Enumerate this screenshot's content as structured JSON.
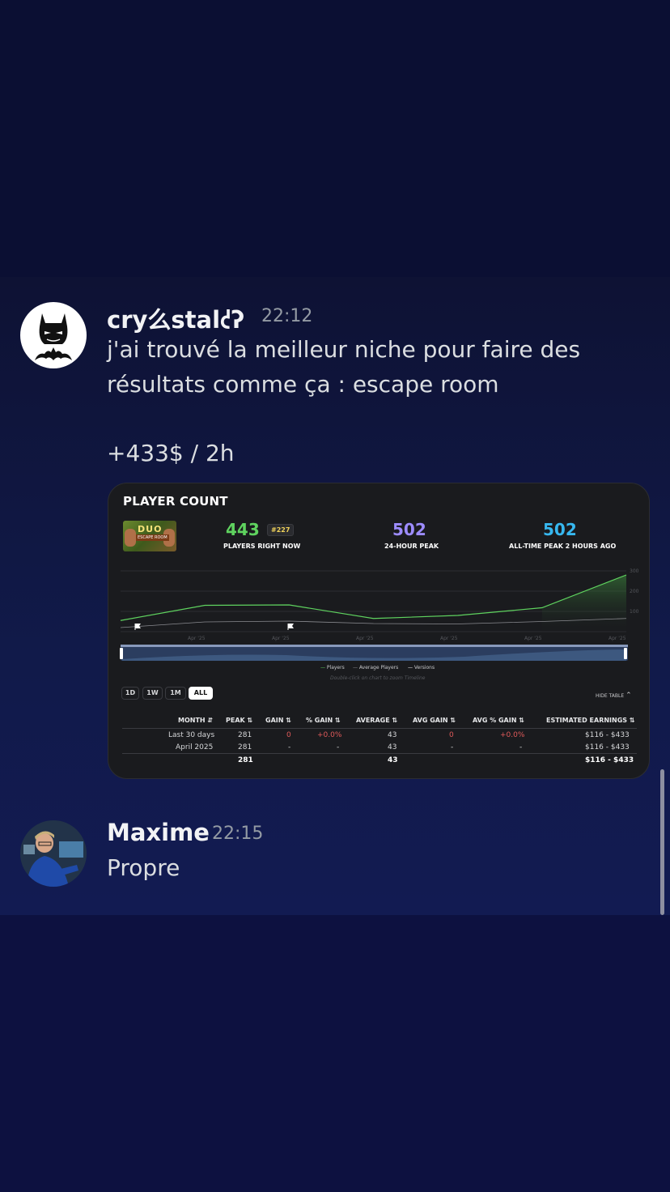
{
  "messages": [
    {
      "username": "cry么stal𐑒ʔ",
      "time": "22:12",
      "lines": [
        "j'ai trouvé la meilleur niche pour faire des",
        "résultats comme ça : escape room",
        "+433$ / 2h"
      ],
      "avatar": "batman-avatar"
    },
    {
      "username": "Maxime",
      "time": "22:15",
      "lines": [
        "Propre"
      ],
      "avatar": "photo-avatar"
    }
  ],
  "embed": {
    "title": "PLAYER COUNT",
    "thumbnail": {
      "line1": "DUO",
      "line2": "ESCAPE ROOM"
    },
    "stats": [
      {
        "value": "443",
        "label": "PLAYERS RIGHT NOW",
        "color": "#5fd35f",
        "badge": "#227"
      },
      {
        "value": "502",
        "label": "24-HOUR PEAK",
        "color": "#9d8cff"
      },
      {
        "value": "502",
        "label": "ALL-TIME PEAK 2 HOURS AGO",
        "color": "#37b8f0"
      }
    ],
    "legend": [
      "Players",
      "Average Players",
      "Versions"
    ],
    "hint": "Double-click on chart to zoom Timeline",
    "ranges": [
      "1D",
      "1W",
      "1M",
      "ALL"
    ],
    "active_range": "ALL",
    "hide_table": "HIDE TABLE",
    "table": {
      "headers": [
        "MONTH",
        "PEAK",
        "GAIN",
        "% GAIN",
        "AVERAGE",
        "AVG GAIN",
        "AVG % GAIN",
        "ESTIMATED EARNINGS"
      ],
      "rows": [
        [
          "Last 30 days",
          "281",
          "0",
          "+0.0%",
          "43",
          "0",
          "+0.0%",
          "$116 - $433"
        ],
        [
          "April 2025",
          "281",
          "-",
          "-",
          "43",
          "-",
          "-",
          "$116 - $433"
        ],
        [
          "",
          "281",
          "",
          "",
          "43",
          "",
          "",
          "$116 - $433"
        ]
      ]
    }
  },
  "chart_data": {
    "type": "line",
    "x": [
      "Apr '25",
      "Apr '25",
      "Apr '25",
      "Apr '25",
      "Apr '25",
      "Apr '25"
    ],
    "series": [
      {
        "name": "Players",
        "values": [
          55,
          130,
          132,
          65,
          80,
          118,
          280
        ],
        "color": "#5fd35f"
      },
      {
        "name": "Average Players",
        "values": [
          20,
          48,
          52,
          40,
          38,
          50,
          65
        ],
        "color": "#8a8b90"
      }
    ],
    "yticks": [
      "300",
      "200",
      "100"
    ],
    "ylim": [
      0,
      300
    ],
    "grid": true,
    "legend_position": "bottom"
  }
}
